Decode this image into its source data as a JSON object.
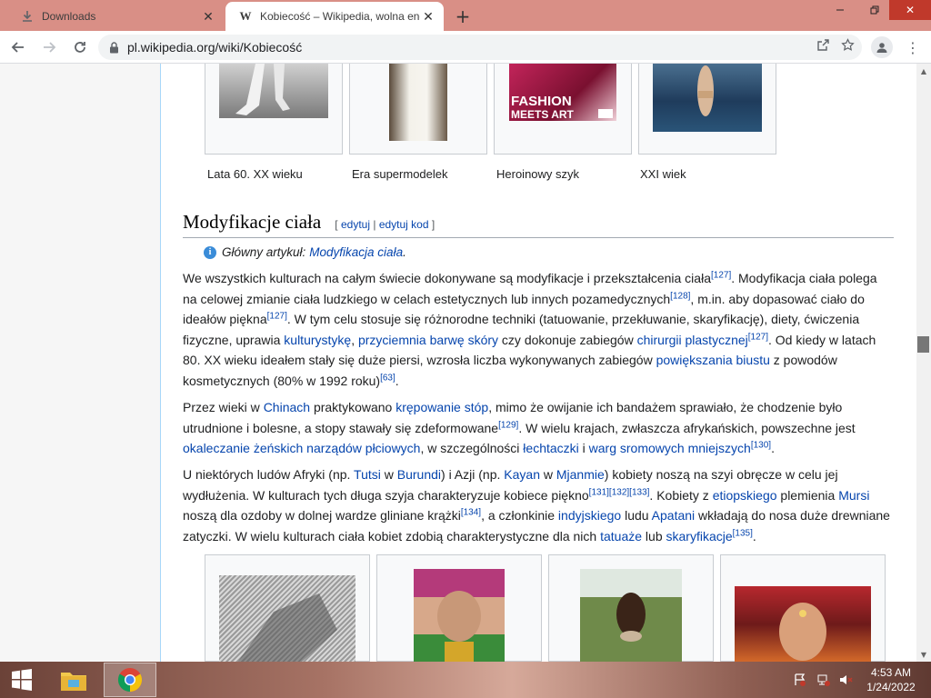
{
  "browser": {
    "tabs": [
      {
        "title": "Downloads",
        "icon": "download-icon"
      },
      {
        "title": "Kobiecość – Wikipedia, wolna encyklopedia",
        "icon": "wikipedia-icon"
      }
    ],
    "url": "pl.wikipedia.org/wiki/Kobiecość"
  },
  "gallery_top": {
    "captions": [
      "Lata 60. XX wieku",
      "Era supermodelek",
      "Heroinowy szyk",
      "XXI wiek"
    ]
  },
  "section": {
    "title": "Modyfikacje ciała",
    "edit_open": "[",
    "edit_link": "edytuj",
    "edit_sep": "|",
    "edit_code_link": "edytuj kod",
    "edit_close": "]"
  },
  "hatnote": {
    "prefix": "Główny artykuł:",
    "link": "Modyfikacja ciała",
    "suffix": "."
  },
  "paragraphs": {
    "p1": {
      "t1": "We wszystkich kulturach na całym świecie dokonywane są modyfikacje i przekształcenia ciała",
      "r1": "[127]",
      "t2": ". Modyfikacja ciała polega na celowej zmianie ciała ludzkiego w celach estetycznych lub innych pozamedycznych",
      "r2": "[128]",
      "t3": ", m.in. aby dopasować ciało do ideałów piękna",
      "r3": "[127]",
      "t4": ". W tym celu stosuje się różnorodne techniki (tatuowanie, przekłuwanie, skaryfikację), diety, ćwiczenia fizyczne, uprawia ",
      "l1": "kulturystykę",
      "t5": ", ",
      "l2": "przyciemnia barwę skóry",
      "t6": " czy dokonuje zabiegów ",
      "l3": "chirurgii plastycznej",
      "r4": "[127]",
      "t7": ". Od kiedy w latach 80. XX wieku ideałem stały się duże piersi, wzrosła liczba wykonywanych zabiegów ",
      "l4": "powiększania biustu",
      "t8": " z powodów kosmetycznych (80% w 1992 roku)",
      "r5": "[63]",
      "t9": "."
    },
    "p2": {
      "t1": "Przez wieki w ",
      "l1": "Chinach",
      "t2": " praktykowano ",
      "l2": "krępowanie stóp",
      "t3": ", mimo że owijanie ich bandażem sprawiało, że chodzenie było utrudnione i bolesne, a stopy stawały się zdeformowane",
      "r1": "[129]",
      "t4": ". W wielu krajach, zwłaszcza afrykańskich, powszechne jest ",
      "l3": "okaleczanie żeńskich narządów płciowych",
      "t5": ", w szczególności ",
      "l4": "łechtaczki",
      "t6": " i ",
      "l5": "warg sromowych mniejszych",
      "r2": "[130]",
      "t7": "."
    },
    "p3": {
      "t1": "U niektórych ludów Afryki (np. ",
      "l1": "Tutsi",
      "t2": " w ",
      "l2": "Burundi",
      "t3": ") i Azji (np. ",
      "l3": "Kayan",
      "t4": " w ",
      "l4": "Mjanmie",
      "t5": ") kobiety noszą na szyi obręcze w celu jej wydłużenia. W kulturach tych długa szyja charakteryzuje kobiece piękno",
      "r1": "[131]",
      "r2": "[132]",
      "r3": "[133]",
      "t6": ". Kobiety z ",
      "l5": "etiopskiego",
      "t7": " plemienia ",
      "l6": "Mursi",
      "t8": " noszą dla ozdoby w dolnej wardze gliniane krążki",
      "r4": "[134]",
      "t9": ", a członkinie ",
      "l7": "indyjskiego",
      "t10": " ludu ",
      "l8": "Apatani",
      "t11": " wkładają do nosa duże drewniane zatyczki. W wielu kulturach ciała kobiet zdobią charakterystyczne dla nich ",
      "l9": "tatuaże",
      "t12": " lub ",
      "l10": "skaryfikacje",
      "r5": "[135]",
      "t13": "."
    }
  },
  "taskbar": {
    "time": "4:53 AM",
    "date": "1/24/2022"
  },
  "colors": {
    "tabstrip": "#d98f86",
    "link": "#0645ad",
    "wiki_border": "#a7d7f9"
  }
}
